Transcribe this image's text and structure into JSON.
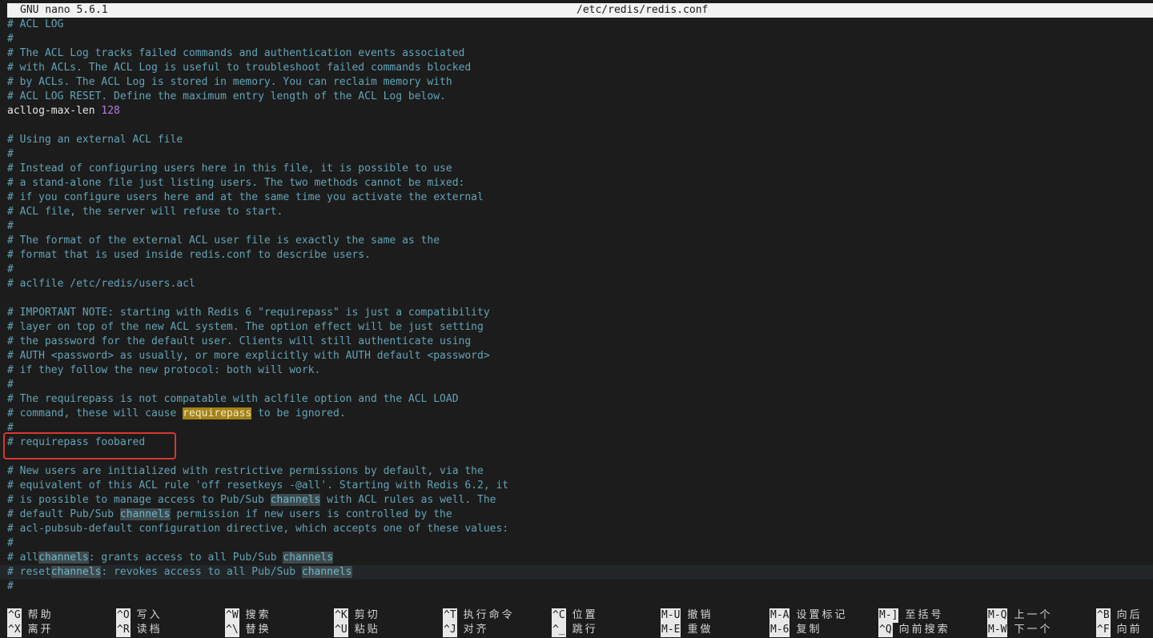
{
  "titlebar": {
    "app": "GNU nano 5.6.1",
    "file": "/etc/redis/redis.conf"
  },
  "editor": {
    "lines": [
      "# ACL LOG",
      "#",
      "# The ACL Log tracks failed commands and authentication events associated",
      "# with ACLs. The ACL Log is useful to troubleshoot failed commands blocked",
      "# by ACLs. The ACL Log is stored in memory. You can reclaim memory with",
      "# ACL LOG RESET. Define the maximum entry length of the ACL Log below.",
      "acllog-max-len 128",
      "",
      "# Using an external ACL file",
      "#",
      "# Instead of configuring users here in this file, it is possible to use",
      "# a stand-alone file just listing users. The two methods cannot be mixed:",
      "# if you configure users here and at the same time you activate the external",
      "# ACL file, the server will refuse to start.",
      "#",
      "# The format of the external ACL user file is exactly the same as the",
      "# format that is used inside redis.conf to describe users.",
      "#",
      "# aclfile /etc/redis/users.acl",
      "",
      "# IMPORTANT NOTE: starting with Redis 6 \"requirepass\" is just a compatibility",
      "# layer on top of the new ACL system. The option effect will be just setting",
      "# the password for the default user. Clients will still authenticate using",
      "# AUTH <password> as usually, or more explicitly with AUTH default <password>",
      "# if they follow the new protocol: both will work.",
      "#",
      "# The requirepass is not compatable with aclfile option and the ACL LOAD",
      "# command, these will cause requirepass to be ignored.",
      "#",
      "# requirepass foobared",
      "",
      "# New users are initialized with restrictive permissions by default, via the",
      "# equivalent of this ACL rule 'off resetkeys -@all'. Starting with Redis 6.2, it",
      "# is possible to manage access to Pub/Sub channels with ACL rules as well. The",
      "# default Pub/Sub channels permission if new users is controlled by the",
      "# acl-pubsub-default configuration directive, which accepts one of these values:",
      "#",
      "# allchannels: grants access to all Pub/Sub channels",
      "# resetchannels: revokes access to all Pub/Sub channels",
      "#"
    ],
    "acllog_key": "acllog-max-len",
    "acllog_value": "128",
    "find_term": "requirepass",
    "channels_term": "channels"
  },
  "shortcuts": [
    {
      "key": "^G",
      "label": "帮助"
    },
    {
      "key": "^X",
      "label": "离开"
    },
    {
      "key": "^O",
      "label": "写入"
    },
    {
      "key": "^R",
      "label": "读档"
    },
    {
      "key": "^W",
      "label": "搜索"
    },
    {
      "key": "^\\",
      "label": "替换"
    },
    {
      "key": "^K",
      "label": "剪切"
    },
    {
      "key": "^U",
      "label": "粘贴"
    },
    {
      "key": "^T",
      "label": "执行命令"
    },
    {
      "key": "^J",
      "label": "对齐"
    },
    {
      "key": "^C",
      "label": "位置"
    },
    {
      "key": "^_",
      "label": "跳行"
    },
    {
      "key": "M-U",
      "label": "撤销"
    },
    {
      "key": "M-E",
      "label": "重做"
    },
    {
      "key": "M-A",
      "label": "设置标记"
    },
    {
      "key": "M-6",
      "label": "复制"
    },
    {
      "key": "M-]",
      "label": "至括号"
    },
    {
      "key": "^Q",
      "label": "向前搜索"
    },
    {
      "key": "M-Q",
      "label": "上一个"
    },
    {
      "key": "M-W",
      "label": "下一个"
    },
    {
      "key": "^B",
      "label": "向后"
    },
    {
      "key": "^F",
      "label": "向前"
    }
  ],
  "colors": {
    "background": "#1c1c1c",
    "comment": "#63a3b6",
    "number": "#b77be0",
    "search_highlight": "#a3831b",
    "annotation_box": "#d8382f"
  }
}
